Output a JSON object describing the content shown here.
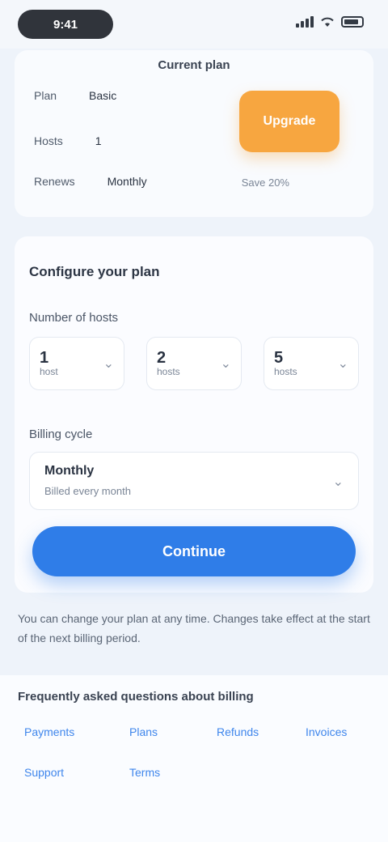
{
  "status": {
    "time": "9:41"
  },
  "account_card": {
    "title": "Current plan",
    "rows": [
      {
        "label": "Plan",
        "value": "Basic"
      },
      {
        "label": "Hosts",
        "value": "1"
      },
      {
        "label": "Renews",
        "value": "Monthly"
      }
    ],
    "upgrade_label": "Upgrade",
    "note": "Save 20%"
  },
  "settings": {
    "section_title": "Configure your plan",
    "count_label": "Number of hosts",
    "steppers": [
      {
        "value": "1",
        "unit": "host"
      },
      {
        "value": "2",
        "unit": "hosts"
      },
      {
        "value": "5",
        "unit": "hosts"
      }
    ],
    "billing_label": "Billing cycle",
    "billing": {
      "title": "Monthly",
      "subtitle": "Billed every month"
    },
    "continue_label": "Continue"
  },
  "help_text": "You can change your plan at any time. Changes take effect at the start of the next billing period.",
  "links": {
    "title": "Frequently asked questions about billing",
    "items": [
      "Payments",
      "Plans",
      "Refunds",
      "Invoices",
      "Support",
      "Terms"
    ]
  }
}
